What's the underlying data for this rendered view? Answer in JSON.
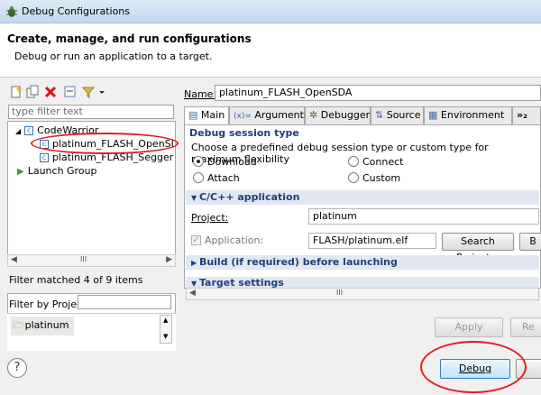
{
  "window": {
    "title": "Debug Configurations"
  },
  "header": {
    "title": "Create, manage, and run configurations",
    "subtitle": "Debug or run an application to a target."
  },
  "sidebar": {
    "filter_placeholder": "type filter text",
    "tree": [
      {
        "label": "CodeWarrior",
        "expanded": true
      },
      {
        "label": "platinum_FLASH_OpenSDA",
        "selected": true
      },
      {
        "label": "platinum_FLASH_Segger J-L"
      },
      {
        "label": "Launch Group"
      }
    ],
    "scroll_thumb": "III",
    "match_text": "Filter matched 4 of 9 items",
    "filter_by_project_label": "Filter by Project:",
    "project_item": "platinum"
  },
  "name": {
    "label": "Name:",
    "value": "platinum_FLASH_OpenSDA"
  },
  "tabs": [
    {
      "label": "Main",
      "active": true
    },
    {
      "label": "Arguments"
    },
    {
      "label": "Debugger"
    },
    {
      "label": "Source"
    },
    {
      "label": "Environment"
    },
    {
      "label": "»₂"
    }
  ],
  "main": {
    "session_title": "Debug session type",
    "session_desc": "Choose a predefined debug session type or custom type for maximum flexibility",
    "radios": [
      {
        "label": "Download",
        "selected": true
      },
      {
        "label": "Connect",
        "selected": false
      },
      {
        "label": "Attach",
        "selected": false
      },
      {
        "label": "Custom",
        "selected": false
      }
    ],
    "cc_section": "C/C++ application",
    "project_label": "Project:",
    "project_value": "platinum",
    "application_label": "Application:",
    "application_value": "FLASH/platinum.elf",
    "search_button": "Search Project...",
    "browse_button": "B",
    "build_section": "Build (if required) before launching",
    "target_section": "Target settings",
    "scroll_thumb": "III"
  },
  "buttons": {
    "apply": "Apply",
    "revert": "Re",
    "debug": "Debug"
  },
  "colors": {
    "annotation": "#e02020",
    "section_text": "#1f3f7a"
  }
}
